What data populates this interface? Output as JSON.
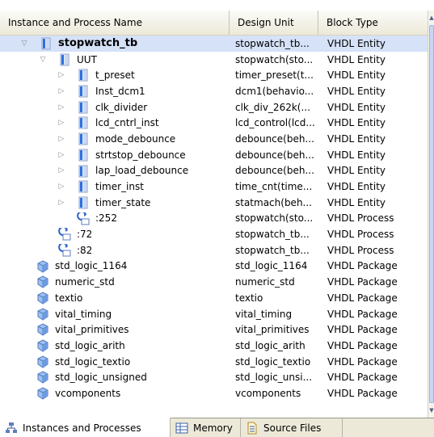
{
  "columns": {
    "name": "Instance and Process Name",
    "unit": "Design Unit",
    "type": "Block Type"
  },
  "rows": [
    {
      "name": "stopwatch_tb",
      "unit": "stopwatch_tb...",
      "type": "VHDL Entity",
      "level": 0,
      "expander": "expanded",
      "icon": "entity-top",
      "selected": true
    },
    {
      "name": "UUT",
      "unit": "stopwatch(sto...",
      "type": "VHDL Entity",
      "level": 1,
      "expander": "expanded",
      "icon": "entity"
    },
    {
      "name": "t_preset",
      "unit": "timer_preset(t...",
      "type": "VHDL Entity",
      "level": 2,
      "expander": "collapsed",
      "icon": "entity"
    },
    {
      "name": "Inst_dcm1",
      "unit": "dcm1(behavio...",
      "type": "VHDL Entity",
      "level": 2,
      "expander": "collapsed",
      "icon": "entity"
    },
    {
      "name": "clk_divider",
      "unit": "clk_div_262k(...",
      "type": "VHDL Entity",
      "level": 2,
      "expander": "collapsed",
      "icon": "entity"
    },
    {
      "name": "lcd_cntrl_inst",
      "unit": "lcd_control(lcd...",
      "type": "VHDL Entity",
      "level": 2,
      "expander": "collapsed",
      "icon": "entity"
    },
    {
      "name": "mode_debounce",
      "unit": "debounce(beh...",
      "type": "VHDL Entity",
      "level": 2,
      "expander": "collapsed",
      "icon": "entity"
    },
    {
      "name": "strtstop_debounce",
      "unit": "debounce(beh...",
      "type": "VHDL Entity",
      "level": 2,
      "expander": "collapsed",
      "icon": "entity"
    },
    {
      "name": "lap_load_debounce",
      "unit": "debounce(beh...",
      "type": "VHDL Entity",
      "level": 2,
      "expander": "collapsed",
      "icon": "entity"
    },
    {
      "name": "timer_inst",
      "unit": "time_cnt(time...",
      "type": "VHDL Entity",
      "level": 2,
      "expander": "collapsed",
      "icon": "entity"
    },
    {
      "name": "timer_state",
      "unit": "statmach(beh...",
      "type": "VHDL Entity",
      "level": 2,
      "expander": "collapsed",
      "icon": "entity"
    },
    {
      "name": ":252",
      "unit": "stopwatch(sto...",
      "type": "VHDL Process",
      "level": 2,
      "expander": "none",
      "icon": "process"
    },
    {
      "name": ":72",
      "unit": "stopwatch_tb...",
      "type": "VHDL Process",
      "level": 1,
      "expander": "none",
      "icon": "process"
    },
    {
      "name": ":82",
      "unit": "stopwatch_tb...",
      "type": "VHDL Process",
      "level": 1,
      "expander": "none",
      "icon": "process"
    },
    {
      "name": "std_logic_1164",
      "unit": "std_logic_1164",
      "type": "VHDL Package",
      "level": 0,
      "expander": "none",
      "icon": "package"
    },
    {
      "name": "numeric_std",
      "unit": "numeric_std",
      "type": "VHDL Package",
      "level": 0,
      "expander": "none",
      "icon": "package"
    },
    {
      "name": "textio",
      "unit": "textio",
      "type": "VHDL Package",
      "level": 0,
      "expander": "none",
      "icon": "package"
    },
    {
      "name": "vital_timing",
      "unit": "vital_timing",
      "type": "VHDL Package",
      "level": 0,
      "expander": "none",
      "icon": "package"
    },
    {
      "name": "vital_primitives",
      "unit": "vital_primitives",
      "type": "VHDL Package",
      "level": 0,
      "expander": "none",
      "icon": "package"
    },
    {
      "name": "std_logic_arith",
      "unit": "std_logic_arith",
      "type": "VHDL Package",
      "level": 0,
      "expander": "none",
      "icon": "package"
    },
    {
      "name": "std_logic_textio",
      "unit": "std_logic_textio",
      "type": "VHDL Package",
      "level": 0,
      "expander": "none",
      "icon": "package"
    },
    {
      "name": "std_logic_unsigned",
      "unit": "std_logic_unsi...",
      "type": "VHDL Package",
      "level": 0,
      "expander": "none",
      "icon": "package"
    },
    {
      "name": "vcomponents",
      "unit": "vcomponents",
      "type": "VHDL Package",
      "level": 0,
      "expander": "none",
      "icon": "package"
    }
  ],
  "tabs": [
    {
      "label": "Instances and Processes",
      "icon": "hierarchy-icon",
      "active": true
    },
    {
      "label": "Memory",
      "icon": "memory-icon",
      "active": false
    },
    {
      "label": "Source Files",
      "icon": "source-files-icon",
      "active": false
    }
  ],
  "colors": {
    "selection": "#d5e2f8",
    "entity_icon": "#3a6fd8",
    "process_icon": "#2f66c7",
    "package_icon": "#5b8fd8"
  }
}
